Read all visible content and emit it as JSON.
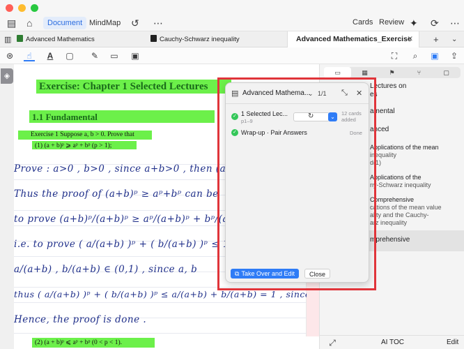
{
  "toolbar": {
    "document_tab": "Document",
    "mindmap_tab": "MindMap",
    "cards": "Cards",
    "review": "Review"
  },
  "tabs": [
    {
      "label": "Advanced Mathematics"
    },
    {
      "label": "Cauchy-Schwarz inequality"
    },
    {
      "label": "Advanced Mathematics_Exercise"
    }
  ],
  "document": {
    "exercise_title": "Exercise:  Chapter 1   Selected Lectures",
    "section_title": "1.1  Fundamental",
    "exercise_1": "Exercise 1  Suppose a, b > 0. Prove that",
    "exercise_1_part1": "(1)  (a + b)ᵖ ⩾ aᵖ + bᵖ   (p > 1);",
    "exercise_1_part2": "(2)  (a + b)ᵖ ⩽ aᵖ + bᵖ   (0 < p < 1).",
    "handwriting": [
      "Prove :  a>0 , b>0 ,  since  a+b>0 ,  then  (a",
      "Thus  the  proof  of  (a+b)ᵖ ≥ aᵖ+bᵖ  can  be",
      "to  prove   (a+b)ᵖ/(a+b)ᵖ  ≥  aᵖ/(a+b)ᵖ  +  bᵖ/(a+b)ᵖ",
      "i.e.  to  prove  ( a/(a+b) )ᵖ + ( b/(a+b) )ᵖ ≤ 1",
      "a/(a+b) ,  b/(a+b)  ∈ (0,1) ,  since  a, b",
      "thus  ( a/(a+b) )ᵖ + ( b/(a+b) )ᵖ ≤  a/(a+b) + b/(a+b) = 1 ,  since  p>1 .",
      "Hence,  the  proof  is  done ."
    ]
  },
  "panel": {
    "title": "Advanced Mathema...",
    "page_indicator": "1/1",
    "rows": [
      {
        "title": "1 Selected Lec...",
        "sub": "p1–9",
        "status": "12 cards added"
      },
      {
        "title": "Wrap-up · Pair Answers",
        "sub": "",
        "status": "Done"
      }
    ],
    "take_over": "Take Over and Edit",
    "close": "Close"
  },
  "sidebar": {
    "toc": [
      {
        "title": "Lectures on",
        "sub": "es"
      },
      {
        "title": "amental",
        "sub": ""
      },
      {
        "title": "anced",
        "sub": ""
      },
      {
        "title": "Applications of the mean",
        "sub": "inequality",
        "sub2": "d(1)"
      },
      {
        "title": "Applications of the",
        "sub": "ny-Schwarz inequality"
      },
      {
        "title": "Comprehensive",
        "sub": "cations of the mean value",
        "sub2": "ality and the Cauchy-",
        "sub3": "arz inequality"
      },
      {
        "title": "mprehensive",
        "sub": ""
      }
    ],
    "ai_toc": "AI TOC",
    "edit": "Edit"
  }
}
